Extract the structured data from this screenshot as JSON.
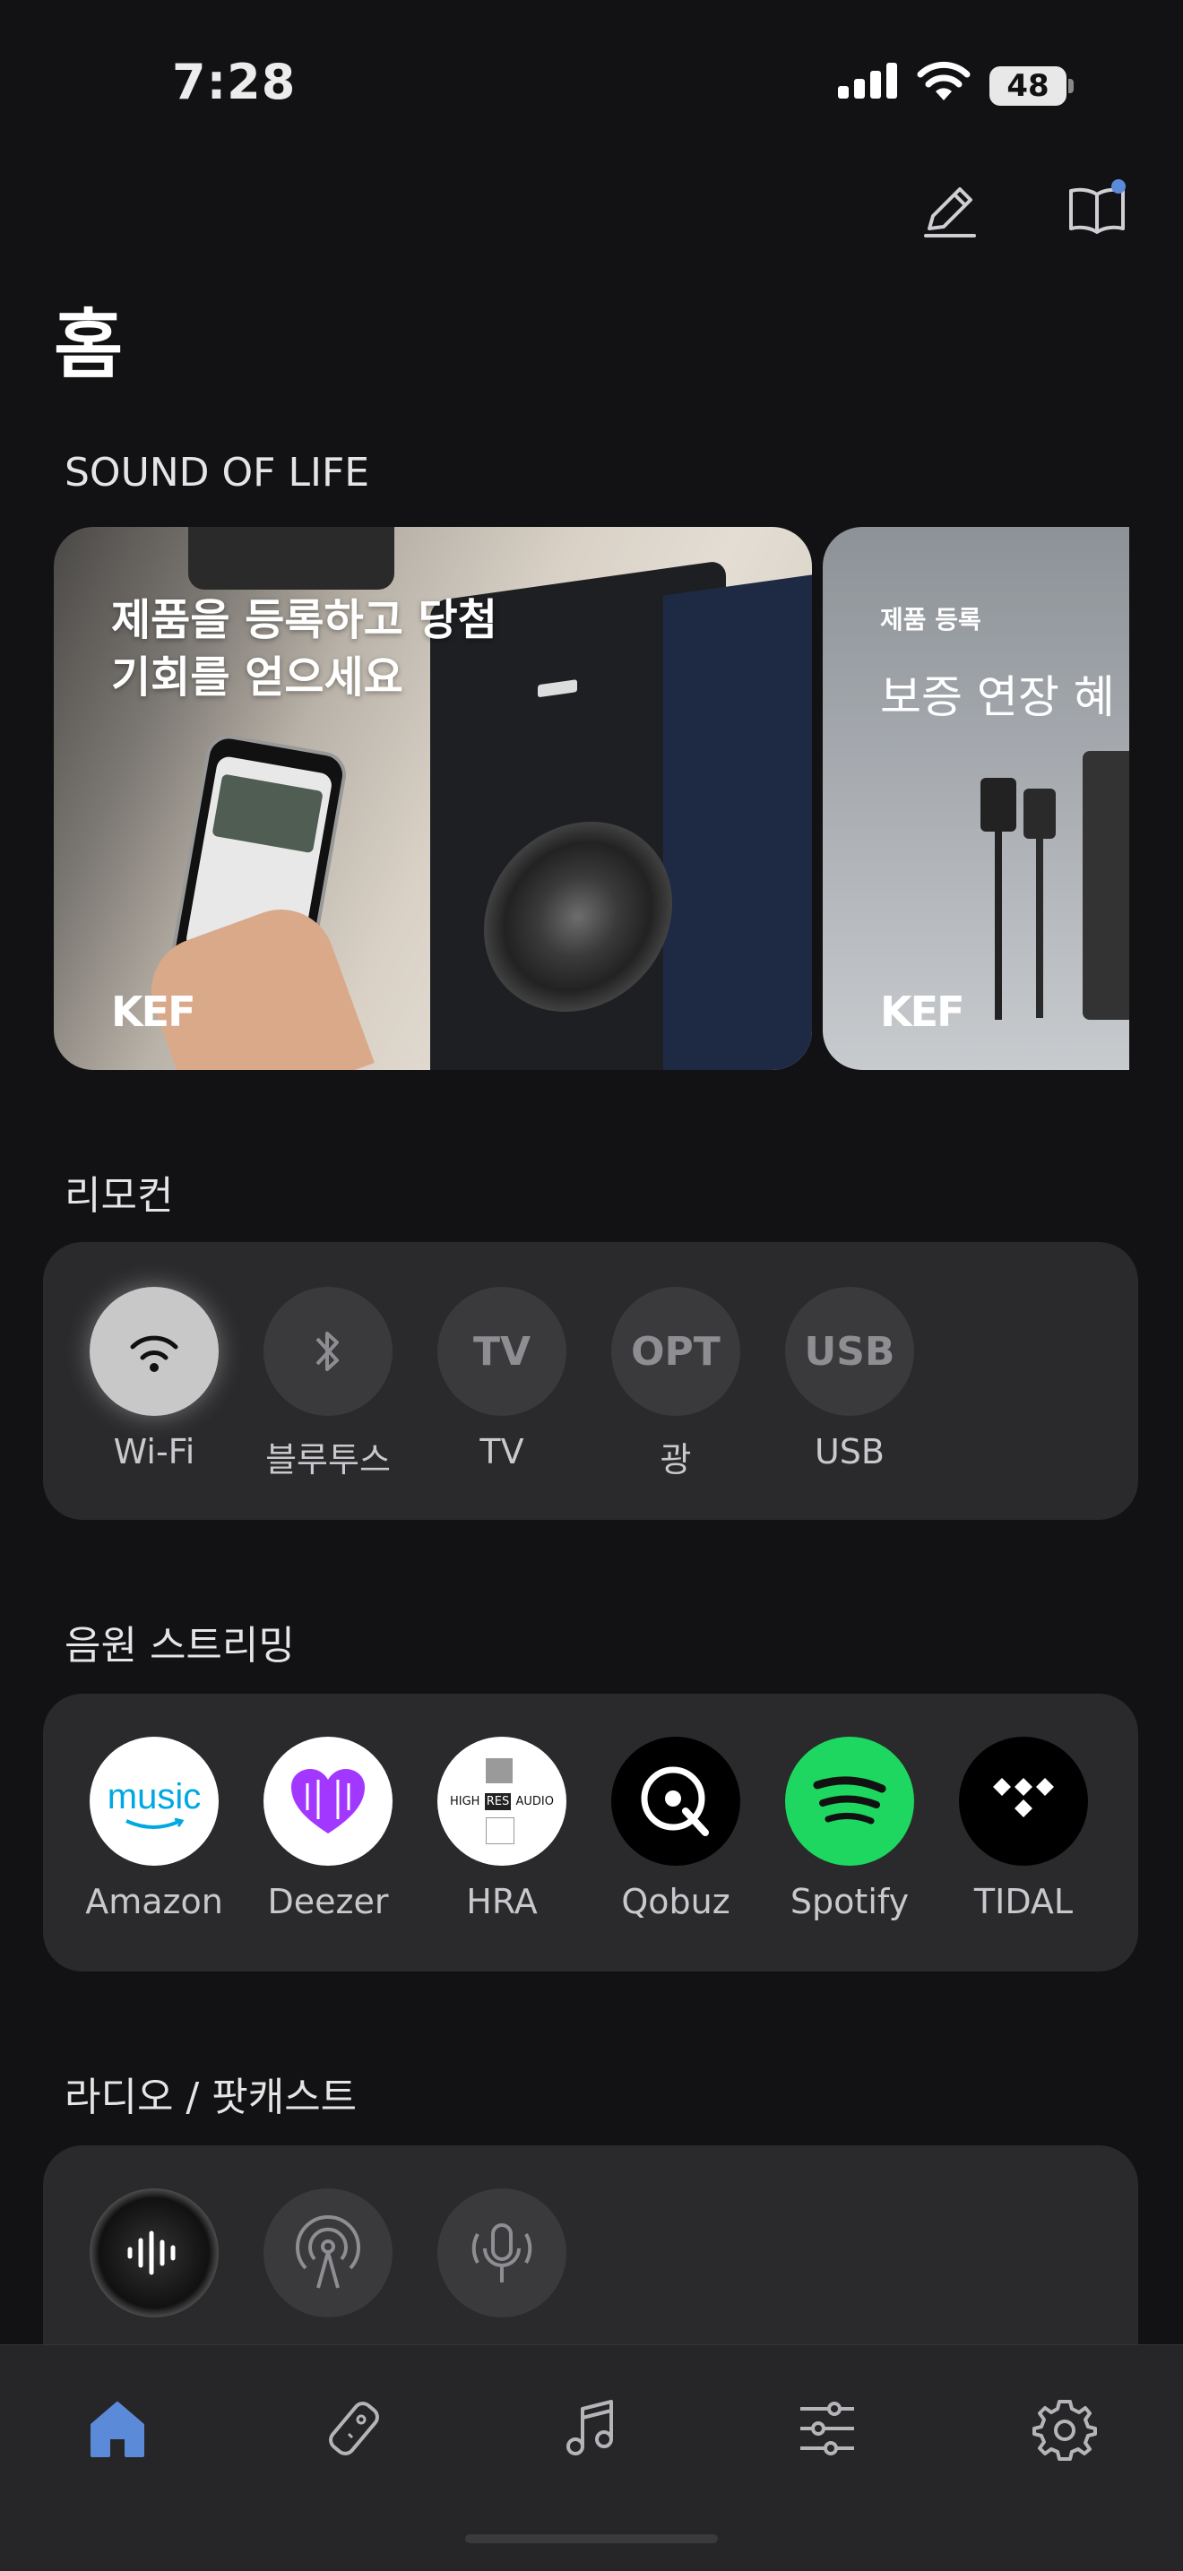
{
  "status_bar": {
    "time": "7:28",
    "battery": "48"
  },
  "page": {
    "title": "홈"
  },
  "sound_of_life": {
    "title": "SOUND OF LIFE",
    "banners": [
      {
        "headline_line1": "제품을 등록하고 당첨",
        "headline_line2": "기회를 얻으세요",
        "brand": "KEF"
      },
      {
        "kicker": "제품 등록",
        "headline": "보증 연장 혜",
        "brand": "KEF"
      }
    ]
  },
  "remote": {
    "title": "리모컨",
    "items": [
      {
        "label": "Wi-Fi",
        "glyph": "",
        "icon": "wifi-icon",
        "active": true
      },
      {
        "label": "블루투스",
        "glyph": "",
        "icon": "bluetooth-icon",
        "active": false
      },
      {
        "label": "TV",
        "glyph": "TV",
        "icon": "tv-text",
        "active": false
      },
      {
        "label": "광",
        "glyph": "OPT",
        "icon": "optical-text",
        "active": false
      },
      {
        "label": "USB",
        "glyph": "USB",
        "icon": "usb-text",
        "active": false
      }
    ]
  },
  "streaming": {
    "title": "음원 스트리밍",
    "items": [
      {
        "label": "Amazon",
        "logo_text": "music"
      },
      {
        "label": "Deezer"
      },
      {
        "label": "HRA",
        "logo_left": "HIGH",
        "logo_mid": "RES",
        "logo_right": "AUDIO"
      },
      {
        "label": "Qobuz"
      },
      {
        "label": "Spotify"
      },
      {
        "label": "TIDAL"
      }
    ]
  },
  "radio": {
    "title": "라디오 / 팟캐스트"
  },
  "colors": {
    "accent": "#5b8bd8",
    "spotify": "#1ed760",
    "deezer": "#a238ff",
    "amazon": "#00a8e1"
  }
}
